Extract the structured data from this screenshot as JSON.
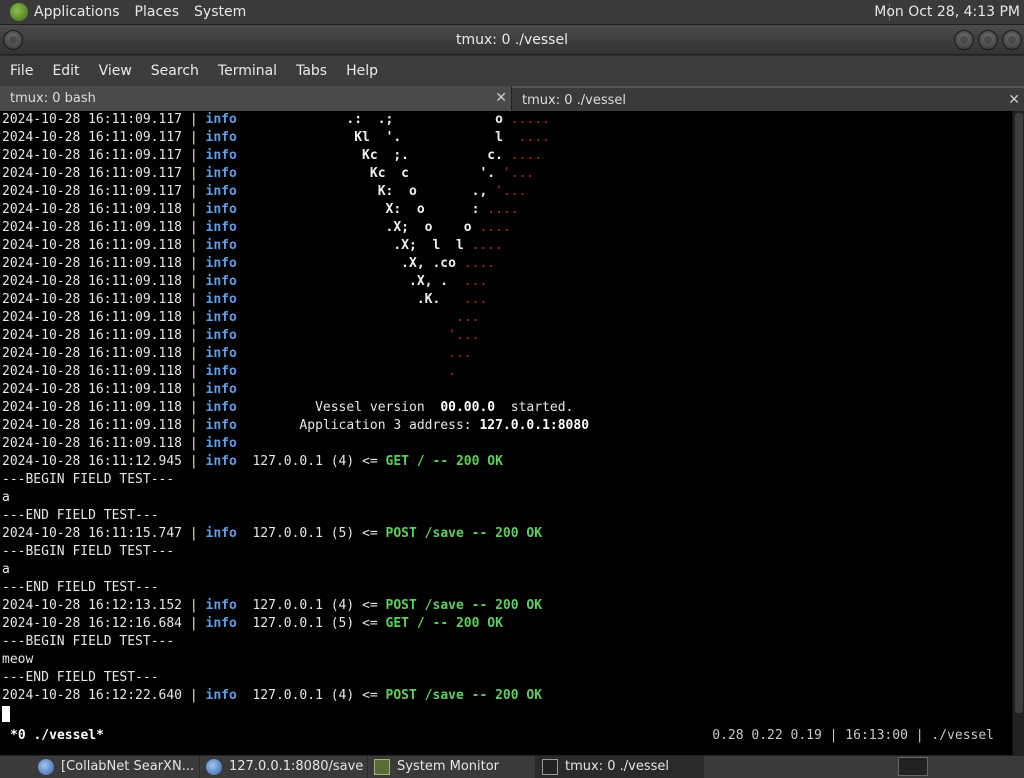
{
  "top_panel": {
    "menus": [
      "Applications",
      "Places",
      "System"
    ],
    "clock": "Mon Oct 28,  4:13 PM"
  },
  "window": {
    "title": "tmux: 0 ./vessel"
  },
  "menubar": [
    "File",
    "Edit",
    "View",
    "Search",
    "Terminal",
    "Tabs",
    "Help"
  ],
  "tabs": [
    {
      "label": "tmux: 0 bash",
      "active": false
    },
    {
      "label": "tmux: 0 ./vessel",
      "active": true
    }
  ],
  "terminal": {
    "art_lines": [
      {
        "ts": "2024-10-28 16:11:09.117",
        "level": "info",
        "art": "            .:  .;             ",
        "art2": "o",
        "dots": " ....."
      },
      {
        "ts": "2024-10-28 16:11:09.117",
        "level": "info",
        "art": "             Kl  '.            ",
        "art2": "l",
        "dots": "  ...."
      },
      {
        "ts": "2024-10-28 16:11:09.117",
        "level": "info",
        "art": "              Kc  ;.          ",
        "art2": "c.",
        "dots": " ...."
      },
      {
        "ts": "2024-10-28 16:11:09.117",
        "level": "info",
        "art": "               Kc  c         ",
        "art2": "'.",
        "dots": " '..."
      },
      {
        "ts": "2024-10-28 16:11:09.117",
        "level": "info",
        "art": "                K:  o       ",
        "art2": ".,",
        "dots": " '..."
      },
      {
        "ts": "2024-10-28 16:11:09.118",
        "level": "info",
        "art": "                 X:  o      ",
        "art2": ":",
        "dots": " ...."
      },
      {
        "ts": "2024-10-28 16:11:09.118",
        "level": "info",
        "art": "                 .X;  o    ",
        "art2": "o",
        "dots": " ...."
      },
      {
        "ts": "2024-10-28 16:11:09.118",
        "level": "info",
        "art": "                  .X;  l  ",
        "art2": "l",
        "dots": " ...."
      },
      {
        "ts": "2024-10-28 16:11:09.118",
        "level": "info",
        "art": "                   .X, ",
        "art2": ".co",
        "dots": " ...."
      },
      {
        "ts": "2024-10-28 16:11:09.118",
        "level": "info",
        "art": "                    .X, .",
        "art2": "",
        "dots": "  ..."
      },
      {
        "ts": "2024-10-28 16:11:09.118",
        "level": "info",
        "art": "                     .K.",
        "art2": "",
        "dots": "   ..."
      },
      {
        "ts": "2024-10-28 16:11:09.118",
        "level": "info",
        "art": "                        ",
        "art2": "",
        "dots": "  ..."
      },
      {
        "ts": "2024-10-28 16:11:09.118",
        "level": "info",
        "art": "                        ",
        "art2": "",
        "dots": " '..."
      },
      {
        "ts": "2024-10-28 16:11:09.118",
        "level": "info",
        "art": "                        ",
        "art2": "",
        "dots": " ..."
      },
      {
        "ts": "2024-10-28 16:11:09.118",
        "level": "info",
        "art": "                        ",
        "art2": "",
        "dots": " ."
      },
      {
        "ts": "2024-10-28 16:11:09.118",
        "level": "info",
        "art": "",
        "art2": "",
        "dots": ""
      }
    ],
    "version_line": {
      "ts": "2024-10-28 16:11:09.118",
      "level": "info",
      "pre": "        Vessel version  ",
      "version": "00.00.0",
      "post": "  started."
    },
    "address_line": {
      "ts": "2024-10-28 16:11:09.118",
      "level": "info",
      "pre": "      Application 3 address: ",
      "address": "127.0.0.1:8080"
    },
    "blank_line": {
      "ts": "2024-10-28 16:11:09.118",
      "level": "info"
    },
    "log": [
      {
        "kind": "req",
        "ts": "2024-10-28 16:11:12.945",
        "level": "info",
        "client": "127.0.0.1 (4) <= ",
        "request": "GET / -- 200 OK"
      },
      {
        "kind": "text",
        "text": "---BEGIN FIELD TEST---"
      },
      {
        "kind": "text",
        "text": "a"
      },
      {
        "kind": "text",
        "text": "---END FIELD TEST---"
      },
      {
        "kind": "req",
        "ts": "2024-10-28 16:11:15.747",
        "level": "info",
        "client": "127.0.0.1 (5) <= ",
        "request": "POST /save -- 200 OK"
      },
      {
        "kind": "text",
        "text": "---BEGIN FIELD TEST---"
      },
      {
        "kind": "text",
        "text": "a"
      },
      {
        "kind": "text",
        "text": "---END FIELD TEST---"
      },
      {
        "kind": "req",
        "ts": "2024-10-28 16:12:13.152",
        "level": "info",
        "client": "127.0.0.1 (4) <= ",
        "request": "POST /save -- 200 OK"
      },
      {
        "kind": "req",
        "ts": "2024-10-28 16:12:16.684",
        "level": "info",
        "client": "127.0.0.1 (5) <= ",
        "request": "GET / -- 200 OK"
      },
      {
        "kind": "text",
        "text": "---BEGIN FIELD TEST---"
      },
      {
        "kind": "text",
        "text": "meow"
      },
      {
        "kind": "text",
        "text": "---END FIELD TEST---"
      },
      {
        "kind": "req",
        "ts": "2024-10-28 16:12:22.640",
        "level": "info",
        "client": "127.0.0.1 (4) <= ",
        "request": "POST /save -- 200 OK"
      }
    ]
  },
  "tmux_status": {
    "left": "*0 ./vessel*",
    "right": "0.28 0.22 0.19 | 16:13:00 | ./vessel"
  },
  "taskbar": [
    {
      "label": "[CollabNet SearXN...",
      "icon": "globe-icon"
    },
    {
      "label": "127.0.0.1:8080/save ...",
      "icon": "globe-icon"
    },
    {
      "label": "System Monitor",
      "icon": "system-monitor-icon"
    },
    {
      "label": "tmux: 0 ./vessel",
      "icon": "terminal-icon",
      "active": true
    }
  ]
}
